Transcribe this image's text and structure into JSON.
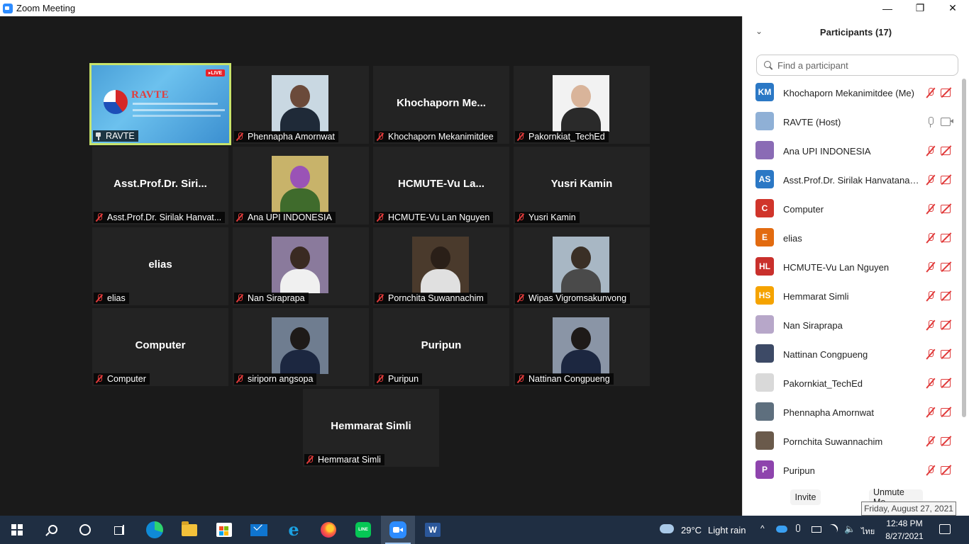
{
  "window": {
    "title": "Zoom Meeting"
  },
  "window_controls": {
    "minimize": "—",
    "maximize": "❐",
    "close": "✕"
  },
  "gallery": {
    "tiles": [
      {
        "display": "",
        "label": "RAVTE",
        "type": "banner",
        "pinned": true
      },
      {
        "display": "",
        "label": "Phennapha Amornwat",
        "type": "photo"
      },
      {
        "display": "Khochaporn  Me...",
        "label": "Khochaporn Mekanimitdee",
        "type": "name"
      },
      {
        "display": "",
        "label": "Pakornkiat_TechEd",
        "type": "photo"
      },
      {
        "display": "Asst.Prof.Dr.  Siri...",
        "label": "Asst.Prof.Dr. Sirilak Hanvat...",
        "type": "name"
      },
      {
        "display": "",
        "label": "Ana UPI INDONESIA",
        "type": "photo"
      },
      {
        "display": "HCMUTE-Vu  La...",
        "label": "HCMUTE-Vu Lan Nguyen",
        "type": "name"
      },
      {
        "display": "Yusri Kamin",
        "label": "Yusri Kamin",
        "type": "name"
      },
      {
        "display": "elias",
        "label": "elias",
        "type": "name"
      },
      {
        "display": "",
        "label": "Nan Siraprapa",
        "type": "photo"
      },
      {
        "display": "",
        "label": "Pornchita Suwannachim",
        "type": "photo"
      },
      {
        "display": "",
        "label": "Wipas Vigromsakunvong",
        "type": "photo"
      },
      {
        "display": "Computer",
        "label": "Computer",
        "type": "name"
      },
      {
        "display": "",
        "label": "siriporn angsopa",
        "type": "photo"
      },
      {
        "display": "Puripun",
        "label": "Puripun",
        "type": "name"
      },
      {
        "display": "",
        "label": "Nattinan Congpueng",
        "type": "photo"
      },
      {
        "display": "Hemmarat Simli",
        "label": "Hemmarat Simli",
        "type": "name"
      }
    ],
    "banner": {
      "brand": "RAVTE",
      "brand_sub": "27-28 AUGUST 2021",
      "live": "▸LIVE"
    }
  },
  "participants": {
    "title": "Participants (17)",
    "search_placeholder": "Find a participant",
    "list": [
      {
        "initials": "KM",
        "name": "Khochaporn Mekanimitdee (Me)",
        "color": "#2b78c5",
        "mic": "off",
        "cam": "off",
        "avatar_type": "initials"
      },
      {
        "initials": "",
        "name": "RAVTE (Host)",
        "color": "#8fb0d6",
        "mic": "on",
        "cam": "on",
        "avatar_type": "image"
      },
      {
        "initials": "",
        "name": "Ana UPI INDONESIA",
        "color": "#8a6bb5",
        "mic": "off",
        "cam": "off",
        "avatar_type": "image"
      },
      {
        "initials": "AS",
        "name": "Asst.Prof.Dr. Sirilak Hanvatanan...",
        "color": "#2b78c5",
        "mic": "off",
        "cam": "off",
        "avatar_type": "initials"
      },
      {
        "initials": "C",
        "name": "Computer",
        "color": "#d0352b",
        "mic": "off",
        "cam": "off",
        "avatar_type": "initials"
      },
      {
        "initials": "E",
        "name": "elias",
        "color": "#e26b10",
        "mic": "off",
        "cam": "off",
        "avatar_type": "initials"
      },
      {
        "initials": "HL",
        "name": "HCMUTE-Vu Lan Nguyen",
        "color": "#c9302c",
        "mic": "off",
        "cam": "off",
        "avatar_type": "initials"
      },
      {
        "initials": "HS",
        "name": "Hemmarat Simli",
        "color": "#f5a300",
        "mic": "off",
        "cam": "off",
        "avatar_type": "initials"
      },
      {
        "initials": "",
        "name": "Nan Siraprapa",
        "color": "#b7a7c9",
        "mic": "off",
        "cam": "off",
        "avatar_type": "image"
      },
      {
        "initials": "",
        "name": "Nattinan Congpueng",
        "color": "#3d4a66",
        "mic": "off",
        "cam": "off",
        "avatar_type": "image"
      },
      {
        "initials": "",
        "name": "Pakornkiat_TechEd",
        "color": "#d9d9d9",
        "mic": "off",
        "cam": "off",
        "avatar_type": "image"
      },
      {
        "initials": "",
        "name": "Phennapha Amornwat",
        "color": "#5e6f7e",
        "mic": "off",
        "cam": "off",
        "avatar_type": "image"
      },
      {
        "initials": "",
        "name": "Pornchita Suwannachim",
        "color": "#6a5a4b",
        "mic": "off",
        "cam": "off",
        "avatar_type": "image"
      },
      {
        "initials": "P",
        "name": "Puripun",
        "color": "#8e44ad",
        "mic": "off",
        "cam": "off",
        "avatar_type": "initials"
      }
    ],
    "actions": {
      "invite": "Invite",
      "unmute": "Unmute Me"
    }
  },
  "tooltip": {
    "text": "Friday, August 27, 2021"
  },
  "taskbar": {
    "apps": [
      {
        "name": "start",
        "active": false
      },
      {
        "name": "search",
        "active": false
      },
      {
        "name": "cortana",
        "active": false
      },
      {
        "name": "task-view",
        "active": false
      },
      {
        "name": "edge",
        "active": false
      },
      {
        "name": "file-explorer",
        "active": false
      },
      {
        "name": "store",
        "active": false
      },
      {
        "name": "mail",
        "active": false
      },
      {
        "name": "internet-explorer",
        "active": false
      },
      {
        "name": "firefox",
        "active": false
      },
      {
        "name": "line",
        "active": false
      },
      {
        "name": "zoom",
        "active": true
      },
      {
        "name": "word",
        "active": false
      }
    ],
    "line_label": "LINE",
    "word_label": "W",
    "ie_label": "e",
    "tray": {
      "temperature": "29°C",
      "weather": "Light rain",
      "chevron": "^",
      "volume": "🔈",
      "language": "ไทย",
      "time": "12:48 PM",
      "date": "8/27/2021"
    }
  }
}
